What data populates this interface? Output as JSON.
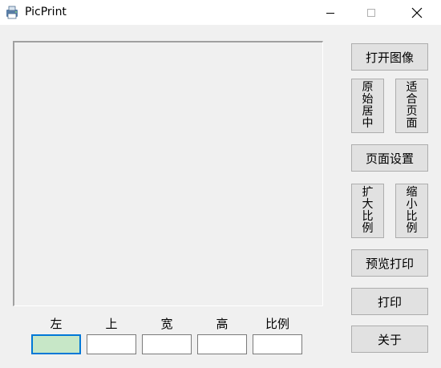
{
  "window": {
    "title": "PicPrint",
    "icon": "picprint-app-icon",
    "controls": {
      "minimize": "minimize-icon",
      "maximize": "maximize-icon",
      "close": "close-icon"
    }
  },
  "buttons": {
    "open_image": "打开图像",
    "original_center": "原始居中",
    "fit_page": "适合页面",
    "page_setup": "页面设置",
    "zoom_in": "扩大比例",
    "zoom_out": "缩小比例",
    "print_preview": "预览打印",
    "print": "打印",
    "about": "关于"
  },
  "fields": {
    "left": {
      "label": "左",
      "value": ""
    },
    "top": {
      "label": "上",
      "value": ""
    },
    "width": {
      "label": "宽",
      "value": ""
    },
    "height": {
      "label": "高",
      "value": ""
    },
    "scale": {
      "label": "比例",
      "value": ""
    }
  },
  "colors": {
    "active_field": "#c7e7c7",
    "button_face": "#e1e1e1",
    "window_bg": "#f0f0f0"
  }
}
